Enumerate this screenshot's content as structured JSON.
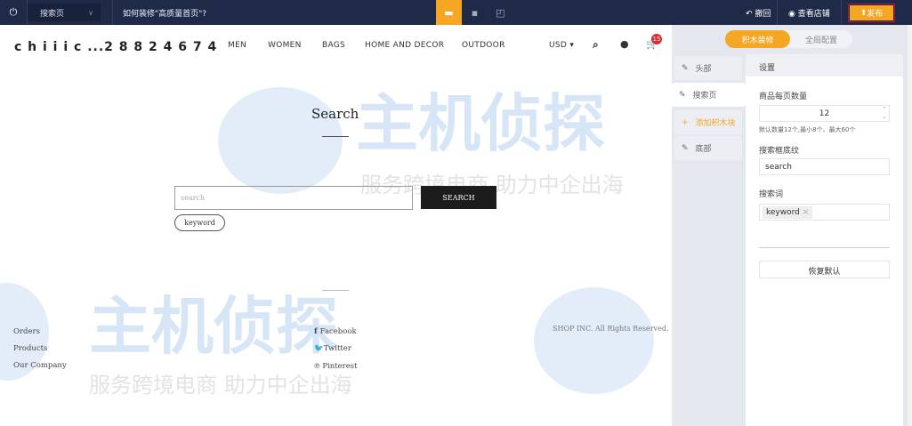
{
  "topbar": {
    "page_select": "搜索页",
    "hint": "如何装修\"高质量首页\"?",
    "undo": "撤回",
    "view_store": "查看店铺",
    "publish": "发布"
  },
  "store": {
    "logo": "c h i i i c ...2 8 8 2 4 6 7 4",
    "nav": [
      "MEN",
      "WOMEN",
      "BAGS",
      "HOME AND DECOR",
      "OUTDOOR"
    ],
    "currency": "USD",
    "cart_count": "15"
  },
  "search_page": {
    "title": "Search",
    "placeholder": "search",
    "button": "SEARCH",
    "keyword": "keyword"
  },
  "footer": {
    "links": [
      "Orders",
      "Products",
      "Our Company"
    ],
    "social": [
      "Facebook",
      "Twitter",
      "Pinterest"
    ],
    "copyright": "SHOP INC. All Rights Reserved."
  },
  "watermark": {
    "brand": "主机侦探",
    "slogan": "服务跨境电商 助力中企出海"
  },
  "panel": {
    "tabs": [
      "积木装修",
      "全局配置"
    ],
    "sections": [
      "头部",
      "搜索页",
      "添加积木块",
      "底部"
    ],
    "settings_title": "设置",
    "per_page_label": "商品每页数量",
    "per_page_value": "12",
    "per_page_hint": "默认数量12个,最小8个、最大60个",
    "placeholder_label": "搜索框底纹",
    "placeholder_value": "search",
    "keywords_label": "搜索词",
    "keyword_tag": "keyword",
    "reset": "恢复默认"
  },
  "colors": {
    "accent": "#f5a623",
    "topbar": "#1e2a47"
  }
}
